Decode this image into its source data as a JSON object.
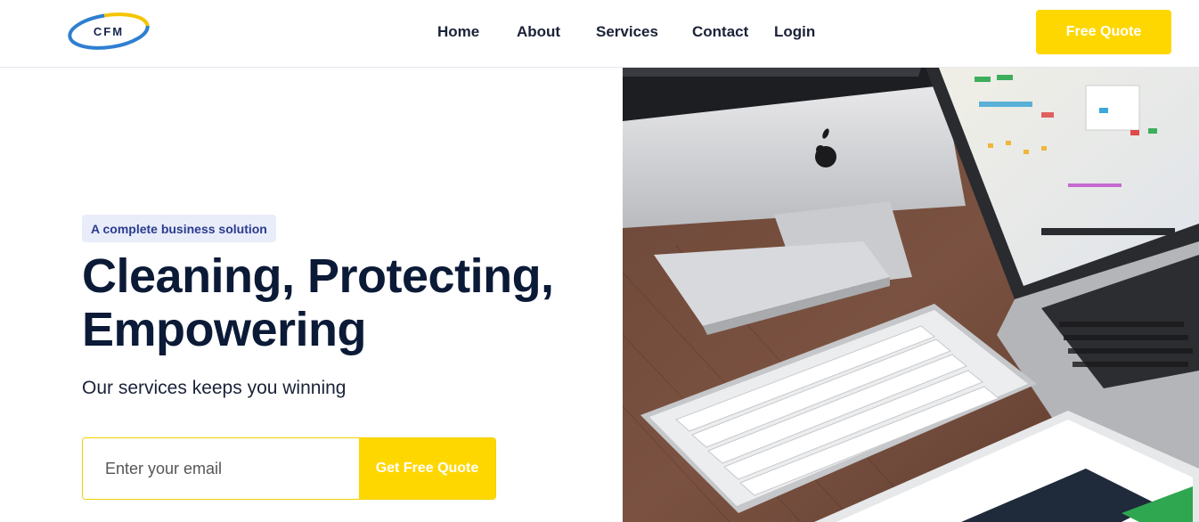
{
  "header": {
    "logo_text": "CFM",
    "nav": [
      {
        "label": "Home"
      },
      {
        "label": "About"
      },
      {
        "label": "Services"
      },
      {
        "label": "Contact"
      },
      {
        "label": "Login"
      }
    ],
    "cta_label": "Free Quote"
  },
  "hero": {
    "badge": "A complete business solution",
    "title_line1": "Cleaning, Protecting,",
    "title_line2": "Empowering",
    "subtitle": "Our services keeps you winning",
    "email_placeholder": "Enter your email",
    "submit_label": "Get Free Quote"
  },
  "colors": {
    "accent": "#ffd700",
    "heading": "#0b1a36",
    "badge_bg": "#e9ecf9",
    "badge_text": "#2a3c8f"
  }
}
